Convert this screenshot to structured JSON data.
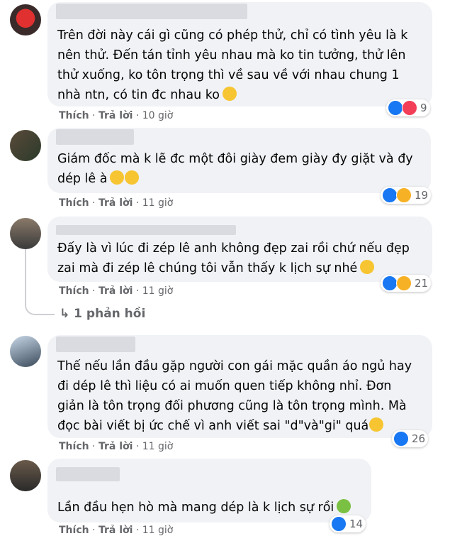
{
  "comments": [
    {
      "text_lines": [
        "Trên đời này cái gì cũng có phép thử, chỉ có tình yêu là k",
        "nên thử. Đến tán tỉnh yêu nhau mà ko tin tưởng, thử lên",
        "thử xuống, ko tôn trọng thì về sau về với nhau chung 1",
        "nhà ntn, có tin đc nhau ko"
      ],
      "like": "Thích",
      "reply": "Trả lời",
      "time": "10 giờ",
      "reaction_count": "9",
      "reaction_icons": [
        "like-icon",
        "love-icon"
      ],
      "trailing_emoji": "emoji-pacman-icon"
    },
    {
      "text_lines": [
        "Giám đốc mà k lẽ đc một đôi giày đem giày đy giặt và đy",
        "dép lê à"
      ],
      "like": "Thích",
      "reply": "Trả lời",
      "time": "11 giờ",
      "reaction_count": "19",
      "reaction_icons": [
        "like-icon",
        "haha-icon"
      ],
      "trailing_emoji": "emoji-thinking-icon"
    },
    {
      "text_lines": [
        "Đấy là vì lúc đi zép lê anh không đẹp zai rồi chứ nếu đẹp",
        "zai mà đi zép lê chúng tôi vẫn thấy k lịch sự nhé"
      ],
      "like": "Thích",
      "reply": "Trả lời",
      "time": "11 giờ",
      "reaction_count": "21",
      "reaction_icons": [
        "like-icon",
        "haha-icon"
      ],
      "trailing_emoji": "emoji-pleading-icon",
      "replies_label": "1 phản hồi"
    },
    {
      "text_lines": [
        "Thế nếu lần đầu gặp người con gái mặc quần áo ngủ hay",
        "đi dép lê thì liệu có ai muốn quen tiếp không nhỉ. Đơn",
        "giản là tôn trọng đối phương cũng là tôn trọng mình. Mà",
        "đọc bài viết bị ức chế vì anh viết sai \"d\"và\"gi\" quá"
      ],
      "like": "Thích",
      "reply": "Trả lời",
      "time": "11 giờ",
      "reaction_count": "26",
      "reaction_icons": [
        "like-icon"
      ],
      "trailing_emoji": "emoji-steam-icon"
    },
    {
      "text_lines": [
        "Lần đầu hẹn hò mà mang dép là k lịch sự rồi"
      ],
      "like": "Thích",
      "reply": "Trả lời",
      "time": "11 giờ",
      "reaction_count": "14",
      "reaction_icons": [
        "like-icon"
      ],
      "trailing_emoji": "emoji-shrug-icon"
    }
  ],
  "colors": {
    "bubble": "#f0f2f5",
    "meta": "#65676b",
    "like": "#1877f2",
    "love": "#f33e58",
    "haha": "#f7b125"
  }
}
